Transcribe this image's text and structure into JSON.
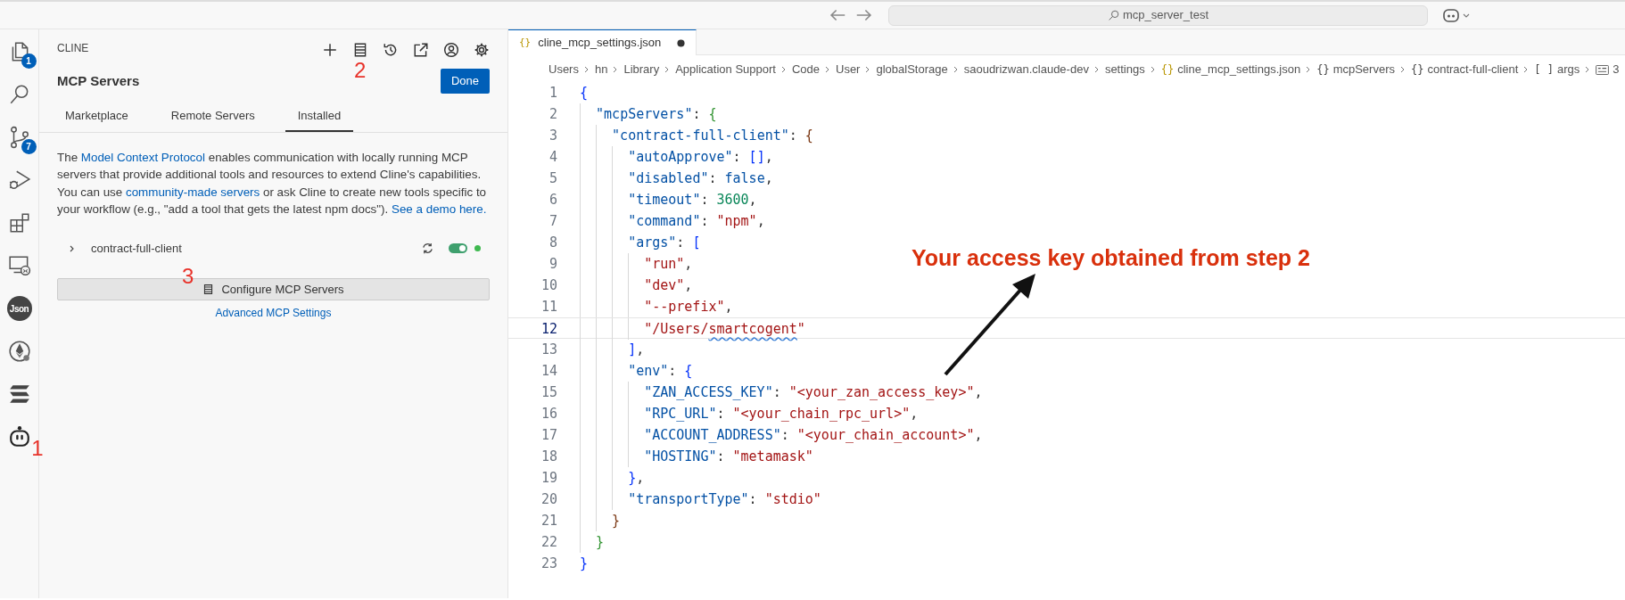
{
  "title_bar": {
    "search": {
      "value": "mcp_server_test"
    }
  },
  "activity_bar": [
    {
      "kind": "files",
      "badge": "1"
    },
    {
      "kind": "search"
    },
    {
      "kind": "source-control",
      "badge": "7"
    },
    {
      "kind": "run-debug"
    },
    {
      "kind": "extensions"
    },
    {
      "kind": "remote"
    },
    {
      "kind": "json",
      "label": "Json"
    },
    {
      "kind": "ethereum"
    },
    {
      "kind": "layers"
    },
    {
      "kind": "robot",
      "step": "1"
    }
  ],
  "side_panel": {
    "title": "CLINE",
    "toolbar": [
      {
        "kind": "plus"
      },
      {
        "kind": "servers",
        "step": "2"
      },
      {
        "kind": "history"
      },
      {
        "kind": "external"
      },
      {
        "kind": "account"
      },
      {
        "kind": "gear"
      }
    ],
    "heading": "MCP Servers",
    "done_button": "Done",
    "tabs": [
      {
        "label": "Marketplace",
        "selected": false
      },
      {
        "label": "Remote Servers",
        "selected": false
      },
      {
        "label": "Installed",
        "selected": true
      }
    ],
    "description": [
      {
        "text": "The ",
        "link": false
      },
      {
        "text": "Model Context Protocol",
        "link": true
      },
      {
        "text": " enables communication with locally running MCP servers that provide additional tools and resources to extend Cline's capabilities. You can use ",
        "link": false
      },
      {
        "text": "community-made servers",
        "link": true
      },
      {
        "text": " or ask Cline to create new tools specific to your workflow (e.g., \"add a tool that gets the latest npm docs\"). ",
        "link": false
      },
      {
        "text": "See a demo here.",
        "link": true
      }
    ],
    "servers": [
      {
        "name": "contract-full-client",
        "expanded": false,
        "enabled": true,
        "color": "#3fb950"
      }
    ],
    "configure_button": {
      "label": "Configure MCP Servers",
      "step": "3"
    },
    "advanced_link": "Advanced MCP Settings"
  },
  "editor": {
    "tabs": [
      {
        "label": "cline_mcp_settings.json",
        "symbol": "{}",
        "modified": true,
        "selected": true
      }
    ],
    "breadcrumb": [
      {
        "text": "Users"
      },
      {
        "text": "hn"
      },
      {
        "text": "Library"
      },
      {
        "text": "Application Support"
      },
      {
        "text": "Code"
      },
      {
        "text": "User"
      },
      {
        "text": "globalStorage"
      },
      {
        "text": "saoudrizwan.claude-dev"
      },
      {
        "text": "settings"
      },
      {
        "text": "cline_mcp_settings.json",
        "symbol": "{}",
        "kind": "file"
      },
      {
        "text": "mcpServers",
        "symbol": "{}",
        "kind": "object"
      },
      {
        "text": "contract-full-client",
        "symbol": "{}",
        "kind": "object"
      },
      {
        "text": "args",
        "symbol": "[ ]",
        "kind": "array"
      },
      {
        "text": "3",
        "kind": "string"
      }
    ],
    "lines": [
      {
        "number": "1",
        "current": false,
        "tokens": [
          {
            "kind": "brace1",
            "text": "{"
          }
        ]
      },
      {
        "number": "2",
        "current": false,
        "tokens": [
          {
            "kind": "key",
            "text": "  \"mcpServers\""
          },
          {
            "kind": "punct",
            "text": ": "
          },
          {
            "kind": "brace2",
            "text": "{"
          }
        ]
      },
      {
        "number": "3",
        "current": false,
        "tokens": [
          {
            "kind": "key",
            "text": "    \"contract-full-client\""
          },
          {
            "kind": "punct",
            "text": ": "
          },
          {
            "kind": "brace3",
            "text": "{"
          }
        ]
      },
      {
        "number": "4",
        "current": false,
        "tokens": [
          {
            "kind": "key",
            "text": "      \"autoApprove\""
          },
          {
            "kind": "punct",
            "text": ": "
          },
          {
            "kind": "brace1",
            "text": "[]"
          },
          {
            "kind": "punct",
            "text": ","
          }
        ]
      },
      {
        "number": "5",
        "current": false,
        "tokens": [
          {
            "kind": "key",
            "text": "      \"disabled\""
          },
          {
            "kind": "punct",
            "text": ": "
          },
          {
            "kind": "keyword",
            "text": "false"
          },
          {
            "kind": "punct",
            "text": ","
          }
        ]
      },
      {
        "number": "6",
        "current": false,
        "tokens": [
          {
            "kind": "key",
            "text": "      \"timeout\""
          },
          {
            "kind": "punct",
            "text": ": "
          },
          {
            "kind": "number",
            "text": "3600"
          },
          {
            "kind": "punct",
            "text": ","
          }
        ]
      },
      {
        "number": "7",
        "current": false,
        "tokens": [
          {
            "kind": "key",
            "text": "      \"command\""
          },
          {
            "kind": "punct",
            "text": ": "
          },
          {
            "kind": "string",
            "text": "\"npm\""
          },
          {
            "kind": "punct",
            "text": ","
          }
        ]
      },
      {
        "number": "8",
        "current": false,
        "tokens": [
          {
            "kind": "key",
            "text": "      \"args\""
          },
          {
            "kind": "punct",
            "text": ": "
          },
          {
            "kind": "brace1",
            "text": "["
          }
        ]
      },
      {
        "number": "9",
        "current": false,
        "tokens": [
          {
            "kind": "string",
            "text": "        \"run\""
          },
          {
            "kind": "punct",
            "text": ","
          }
        ]
      },
      {
        "number": "10",
        "current": false,
        "tokens": [
          {
            "kind": "string",
            "text": "        \"dev\""
          },
          {
            "kind": "punct",
            "text": ","
          }
        ]
      },
      {
        "number": "11",
        "current": false,
        "tokens": [
          {
            "kind": "string",
            "text": "        \"--prefix\""
          },
          {
            "kind": "punct",
            "text": ","
          }
        ]
      },
      {
        "number": "12",
        "current": true,
        "tokens": [
          {
            "kind": "string",
            "text": "        \"/Users/"
          },
          {
            "kind": "string",
            "text": "smartcogent",
            "squiggle": true
          },
          {
            "kind": "string",
            "text": "\""
          }
        ]
      },
      {
        "number": "13",
        "current": false,
        "tokens": [
          {
            "kind": "brace1",
            "text": "      ]"
          },
          {
            "kind": "punct",
            "text": ","
          }
        ]
      },
      {
        "number": "14",
        "current": false,
        "tokens": [
          {
            "kind": "key",
            "text": "      \"env\""
          },
          {
            "kind": "punct",
            "text": ": "
          },
          {
            "kind": "brace1",
            "text": "{"
          }
        ]
      },
      {
        "number": "15",
        "current": false,
        "tokens": [
          {
            "kind": "key",
            "text": "        \"ZAN_ACCESS_KEY\""
          },
          {
            "kind": "punct",
            "text": ": "
          },
          {
            "kind": "string",
            "text": "\"<your_zan_access_key>\""
          },
          {
            "kind": "punct",
            "text": ","
          }
        ]
      },
      {
        "number": "16",
        "current": false,
        "tokens": [
          {
            "kind": "key",
            "text": "        \"RPC_URL\""
          },
          {
            "kind": "punct",
            "text": ": "
          },
          {
            "kind": "string",
            "text": "\"<your_chain_rpc_url>\""
          },
          {
            "kind": "punct",
            "text": ","
          }
        ]
      },
      {
        "number": "17",
        "current": false,
        "tokens": [
          {
            "kind": "key",
            "text": "        \"ACCOUNT_ADDRESS\""
          },
          {
            "kind": "punct",
            "text": ": "
          },
          {
            "kind": "string",
            "text": "\"<your_chain_account>\""
          },
          {
            "kind": "punct",
            "text": ","
          }
        ]
      },
      {
        "number": "18",
        "current": false,
        "tokens": [
          {
            "kind": "key",
            "text": "        \"HOSTING\""
          },
          {
            "kind": "punct",
            "text": ": "
          },
          {
            "kind": "string",
            "text": "\"metamask\""
          }
        ]
      },
      {
        "number": "19",
        "current": false,
        "tokens": [
          {
            "kind": "brace1",
            "text": "      }"
          },
          {
            "kind": "punct",
            "text": ","
          }
        ]
      },
      {
        "number": "20",
        "current": false,
        "tokens": [
          {
            "kind": "key",
            "text": "      \"transportType\""
          },
          {
            "kind": "punct",
            "text": ": "
          },
          {
            "kind": "string",
            "text": "\"stdio\""
          }
        ]
      },
      {
        "number": "21",
        "current": false,
        "tokens": [
          {
            "kind": "brace3",
            "text": "    }"
          }
        ]
      },
      {
        "number": "22",
        "current": false,
        "tokens": [
          {
            "kind": "brace2",
            "text": "  }"
          }
        ]
      },
      {
        "number": "23",
        "current": false,
        "tokens": [
          {
            "kind": "brace1",
            "text": "}"
          }
        ]
      }
    ],
    "annotation": {
      "text": "Your access key obtained from step 2"
    }
  }
}
